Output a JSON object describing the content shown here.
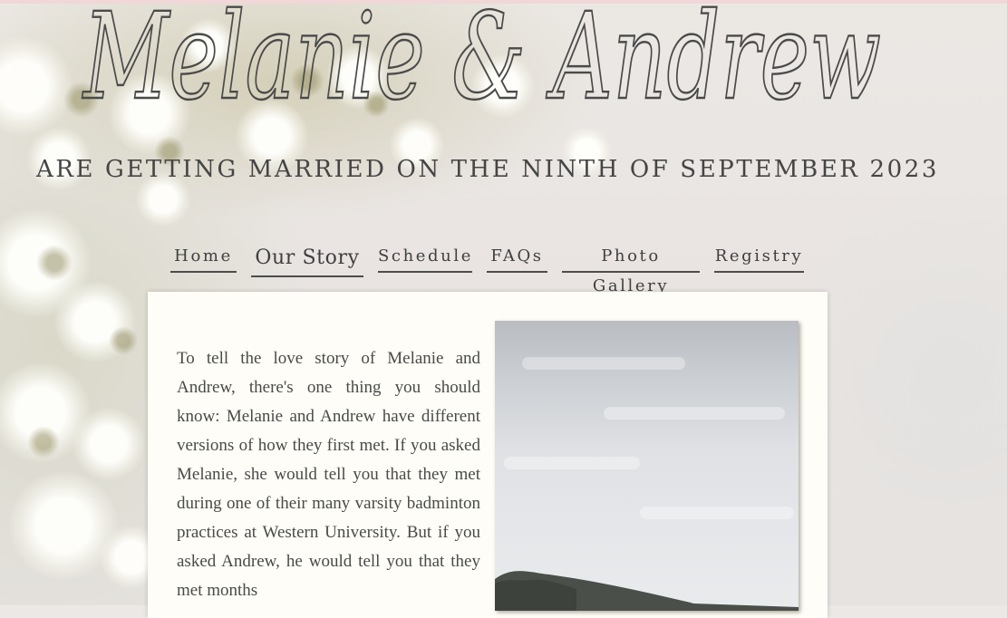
{
  "header": {
    "names": "Melanie & Andrew",
    "announcement": "ARE GETTING MARRIED ON THE NINTH OF SEPTEMBER 2023"
  },
  "nav": {
    "items": [
      "Home",
      "Our Story",
      "Schedule",
      "FAQs",
      "Photo Gallery",
      "Registry"
    ],
    "active": "Our Story"
  },
  "story": {
    "text": "To tell the love story of Melanie and Andrew, there's one thing you should know: Melanie and Andrew have different versions of how they first met. If you asked Melanie, she would tell you that they met during one of their many varsity badminton practices at Western University. But if you asked Andrew, he would tell you that they met months"
  },
  "colors": {
    "text": "#454545",
    "card": "#fefdf7",
    "accent_strip": "#f1d7d8"
  }
}
